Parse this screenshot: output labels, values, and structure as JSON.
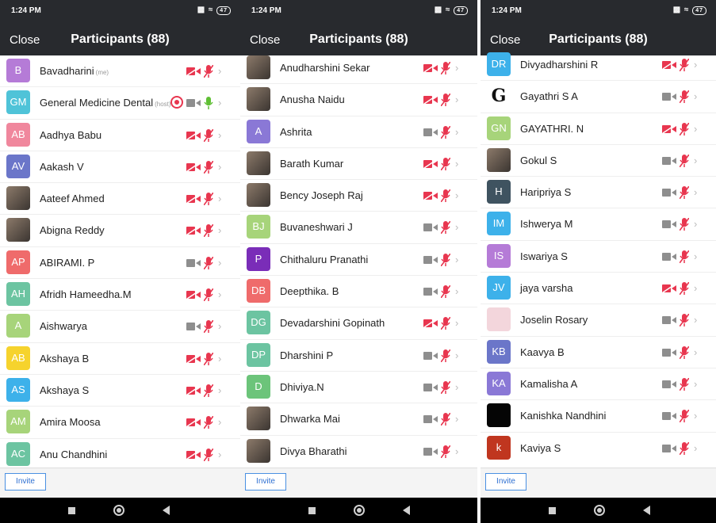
{
  "colors": {
    "header_bg": "#282a2e",
    "muted_red": "#e8364f",
    "muted_gray": "#8e8e8e",
    "unmuted_green": "#5fbf34",
    "invite_border": "#4a90e2"
  },
  "screens": [
    {
      "status_time": "1:24 PM",
      "battery": "47",
      "close_label": "Close",
      "title": "Participants (88)",
      "invite_label": "Invite",
      "participants": [
        {
          "initials": "B",
          "color": "#b57bd7",
          "name": "Bavadharini",
          "tag": "(me)",
          "video": "off-red",
          "audio": "muted-red"
        },
        {
          "initials": "GM",
          "color": "#4fc3d8",
          "name": "General Medicine Dental",
          "tag": "(host)",
          "video": "off-gray",
          "audio": "on-green",
          "recording": true
        },
        {
          "initials": "AB",
          "color": "#f0879d",
          "name": "Aadhya Babu",
          "tag": "",
          "video": "off-red",
          "audio": "muted-red"
        },
        {
          "initials": "AV",
          "color": "#6b76c9",
          "name": "Aakash V",
          "tag": "",
          "video": "off-red",
          "audio": "muted-red"
        },
        {
          "initials": "",
          "color": "photo",
          "name": "Aateef Ahmed",
          "tag": "",
          "video": "off-red",
          "audio": "muted-red"
        },
        {
          "initials": "",
          "color": "photo",
          "name": "Abigna Reddy",
          "tag": "",
          "video": "off-red",
          "audio": "muted-red"
        },
        {
          "initials": "AP",
          "color": "#ef6b6b",
          "name": "ABIRAMI. P",
          "tag": "",
          "video": "off-gray",
          "audio": "muted-red"
        },
        {
          "initials": "AH",
          "color": "#6cc4a1",
          "name": "Afridh Hameedha.M",
          "tag": "",
          "video": "off-red",
          "audio": "muted-red"
        },
        {
          "initials": "A",
          "color": "#a7d47a",
          "name": "Aishwarya",
          "tag": "",
          "video": "off-gray",
          "audio": "muted-red"
        },
        {
          "initials": "AB",
          "color": "#f6d32d",
          "name": "Akshaya B",
          "tag": "",
          "video": "off-red",
          "audio": "muted-red"
        },
        {
          "initials": "AS",
          "color": "#3db1ea",
          "name": "Akshaya S",
          "tag": "",
          "video": "off-red",
          "audio": "muted-red"
        },
        {
          "initials": "AM",
          "color": "#a7d47a",
          "name": "Amira Moosa",
          "tag": "",
          "video": "off-red",
          "audio": "muted-red"
        },
        {
          "initials": "AC",
          "color": "#6cc4a1",
          "name": "Anu Chandhini",
          "tag": "",
          "video": "off-red",
          "audio": "muted-red"
        }
      ]
    },
    {
      "status_time": "1:24 PM",
      "battery": "47",
      "close_label": "Close",
      "title": "Participants (88)",
      "invite_label": "Invite",
      "participants": [
        {
          "initials": "",
          "color": "photo",
          "name": "Anudharshini Sekar",
          "tag": "",
          "video": "off-red",
          "audio": "muted-red"
        },
        {
          "initials": "",
          "color": "photo",
          "name": "Anusha Naidu",
          "tag": "",
          "video": "off-red",
          "audio": "muted-red"
        },
        {
          "initials": "A",
          "color": "#8a78d6",
          "name": "Ashrita",
          "tag": "",
          "video": "off-gray",
          "audio": "muted-red"
        },
        {
          "initials": "",
          "color": "photo",
          "name": "Barath Kumar",
          "tag": "",
          "video": "off-red",
          "audio": "muted-red"
        },
        {
          "initials": "",
          "color": "photo",
          "name": "Bency Joseph Raj",
          "tag": "",
          "video": "off-red",
          "audio": "muted-red"
        },
        {
          "initials": "BJ",
          "color": "#a7d47a",
          "name": "Buvaneshwari J",
          "tag": "",
          "video": "off-gray",
          "audio": "muted-red"
        },
        {
          "initials": "P",
          "color": "#7a2db8",
          "name": "Chithaluru Pranathi",
          "tag": "",
          "video": "off-gray",
          "audio": "muted-red"
        },
        {
          "initials": "DB",
          "color": "#ef6b6b",
          "name": "Deepthika. B",
          "tag": "",
          "video": "off-gray",
          "audio": "muted-red"
        },
        {
          "initials": "DG",
          "color": "#6cc4a1",
          "name": "Devadarshini Gopinath",
          "tag": "",
          "video": "off-red",
          "audio": "muted-red"
        },
        {
          "initials": "DP",
          "color": "#6cc4a1",
          "name": "Dharshini P",
          "tag": "",
          "video": "off-gray",
          "audio": "muted-red"
        },
        {
          "initials": "D",
          "color": "#6cc47a",
          "name": "Dhiviya.N",
          "tag": "",
          "video": "off-gray",
          "audio": "muted-red"
        },
        {
          "initials": "",
          "color": "photo",
          "name": "Dhwarka Mai",
          "tag": "",
          "video": "off-gray",
          "audio": "muted-red"
        },
        {
          "initials": "",
          "color": "photo",
          "name": "Divya Bharathi",
          "tag": "",
          "video": "off-gray",
          "audio": "muted-red"
        }
      ]
    },
    {
      "status_time": "1:24 PM",
      "battery": "47",
      "close_label": "Close",
      "title": "Participants (88)",
      "invite_label": "Invite",
      "participants": [
        {
          "initials": "DR",
          "color": "#3db1ea",
          "name": "Divyadharshini R",
          "tag": "",
          "video": "off-red",
          "audio": "muted-red"
        },
        {
          "initials": "G",
          "color": "logo",
          "name": "Gayathri S A",
          "tag": "",
          "video": "off-gray",
          "audio": "muted-red"
        },
        {
          "initials": "GN",
          "color": "#a7d47a",
          "name": "GAYATHRI. N",
          "tag": "",
          "video": "off-red",
          "audio": "muted-red"
        },
        {
          "initials": "",
          "color": "photo",
          "name": "Gokul S",
          "tag": "",
          "video": "off-gray",
          "audio": "muted-red"
        },
        {
          "initials": "H",
          "color": "#3f5360",
          "name": "Haripriya S",
          "tag": "",
          "video": "off-gray",
          "audio": "muted-red"
        },
        {
          "initials": "IM",
          "color": "#3db1ea",
          "name": "Ishwerya M",
          "tag": "",
          "video": "off-gray",
          "audio": "muted-red"
        },
        {
          "initials": "IS",
          "color": "#b57bd7",
          "name": "Iswariya S",
          "tag": "",
          "video": "off-gray",
          "audio": "muted-red"
        },
        {
          "initials": "JV",
          "color": "#3db1ea",
          "name": "jaya varsha",
          "tag": "",
          "video": "off-red",
          "audio": "muted-red"
        },
        {
          "initials": "",
          "color": "photo-light",
          "name": "Joselin Rosary",
          "tag": "",
          "video": "off-gray",
          "audio": "muted-red"
        },
        {
          "initials": "KB",
          "color": "#6b76c9",
          "name": "Kaavya B",
          "tag": "",
          "video": "off-gray",
          "audio": "muted-red"
        },
        {
          "initials": "KA",
          "color": "#8a78d6",
          "name": "Kamalisha A",
          "tag": "",
          "video": "off-gray",
          "audio": "muted-red"
        },
        {
          "initials": "",
          "color": "#050505",
          "name": "Kanishka Nandhini",
          "tag": "",
          "video": "off-gray",
          "audio": "muted-red"
        },
        {
          "initials": "k",
          "color": "#c0361f",
          "name": "Kaviya S",
          "tag": "",
          "video": "off-gray",
          "audio": "muted-red"
        }
      ]
    }
  ]
}
